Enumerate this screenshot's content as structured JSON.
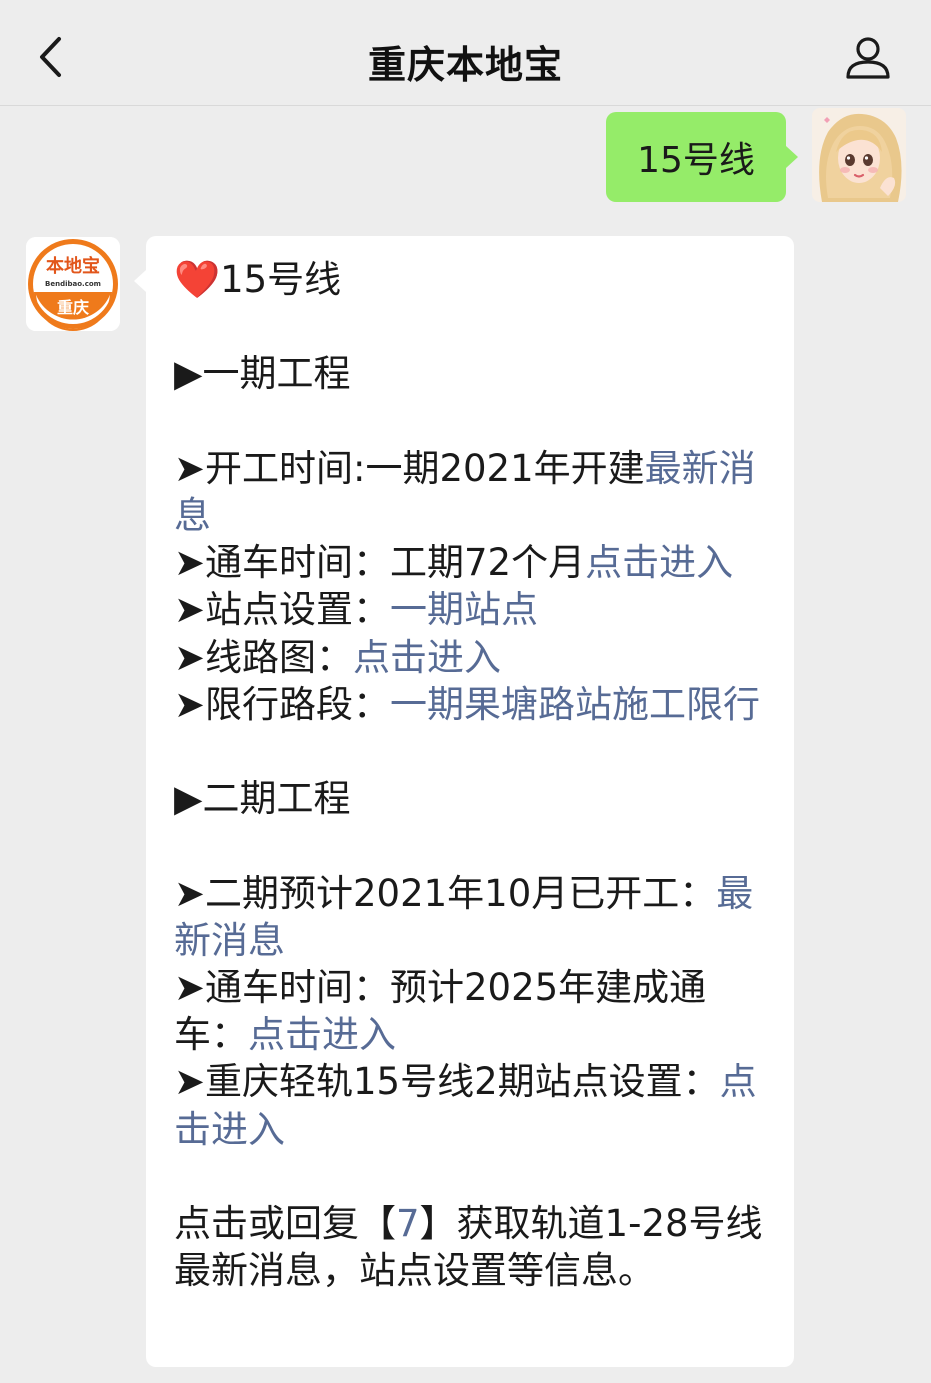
{
  "header": {
    "title": "重庆本地宝"
  },
  "outgoing_message": {
    "text": "15号线"
  },
  "bot": {
    "logo_main": "本地宝",
    "logo_domain": "Bendibao.com",
    "logo_city": "重庆"
  },
  "reply": {
    "heading_icon": "❤️",
    "heading": "15号线",
    "phase1_title": "▶一期工程",
    "phase1_start_label": "➤开工时间:一期2021年开建",
    "phase1_start_link": "最新消息",
    "phase1_open_label": "➤通车时间：工期72个月",
    "phase1_open_link": "点击进入",
    "phase1_stations_label": "➤站点设置：",
    "phase1_stations_link": "一期站点",
    "phase1_map_label": "➤线路图：",
    "phase1_map_link": "点击进入",
    "phase1_restrict_label": "➤限行路段：",
    "phase1_restrict_link": "一期果塘路站施工限行",
    "phase2_title": "▶二期工程",
    "phase2_start_label": "➤二期预计2021年10月已开工：",
    "phase2_start_link": "最新消息",
    "phase2_open_label": "➤通车时间：预计2025年建成通车：",
    "phase2_open_link": "点击进入",
    "phase2_stations_label": "➤重庆轻轨15号线2期站点设置：",
    "phase2_stations_link": "点击进入",
    "footer_before": "点击或回复【",
    "footer_code": "7",
    "footer_after": "】获取轨道1-28号线最新消息，站点设置等信息。"
  }
}
